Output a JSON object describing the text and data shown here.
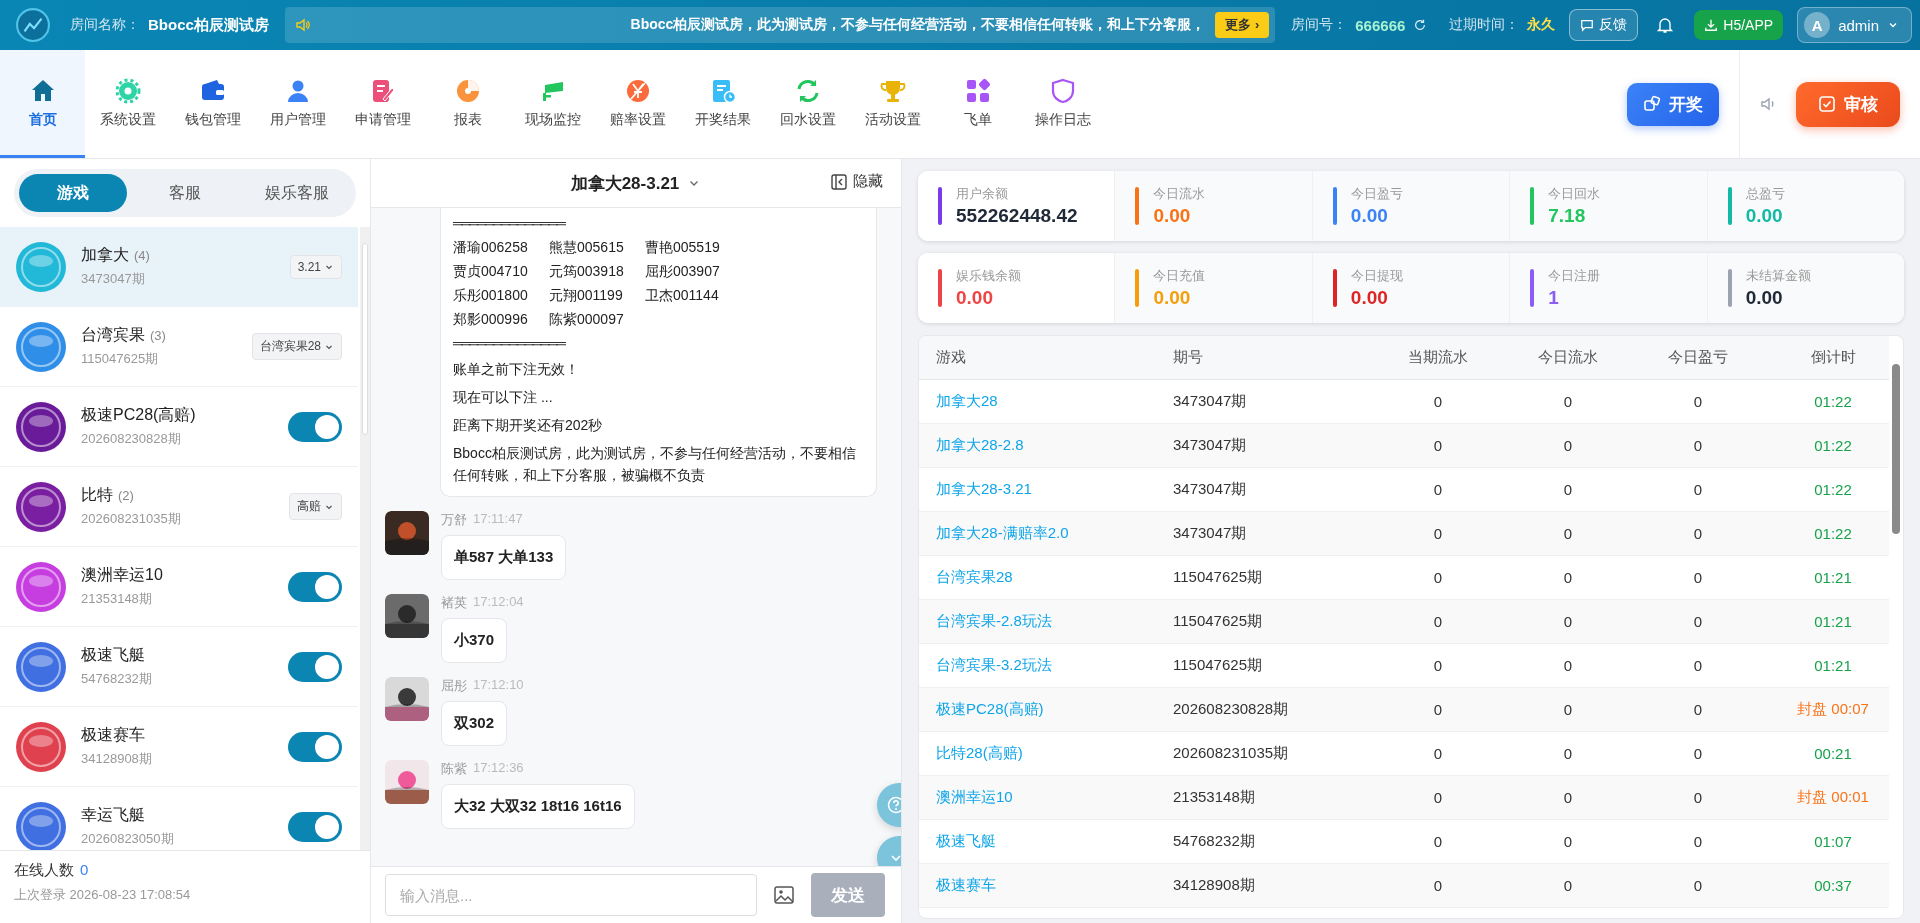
{
  "top_bar": {
    "room_label": "房间名称：",
    "room_name": "Bbocc柏辰测试房",
    "ticker": "Bbocc柏辰测试房，此为测试房，不参与任何经营活动，不要相信任何转账，和上下分客服，",
    "more_button": "更多 ›",
    "room_no_label": "房间号：",
    "room_no": "666666",
    "expire_label": "过期时间：",
    "expire": "永久",
    "feedback_button": "反馈",
    "app_button": "H5/APP",
    "user": {
      "avatar": "A",
      "name": "admin"
    }
  },
  "nav": [
    {
      "label": "首页",
      "selected": true
    },
    {
      "label": "系统设置",
      "selected": false
    },
    {
      "label": "钱包管理",
      "selected": false
    },
    {
      "label": "用户管理",
      "selected": false
    },
    {
      "label": "申请管理",
      "selected": false
    },
    {
      "label": "报表",
      "selected": false
    },
    {
      "label": "现场监控",
      "selected": false
    },
    {
      "label": "赔率设置",
      "selected": false
    },
    {
      "label": "开奖结果",
      "selected": false
    },
    {
      "label": "回水设置",
      "selected": false
    },
    {
      "label": "活动设置",
      "selected": false
    },
    {
      "label": "飞单",
      "selected": false
    },
    {
      "label": "操作日志",
      "selected": false
    }
  ],
  "draw_button": "开奖",
  "review_button": "审核",
  "left_tabs": [
    {
      "label": "游戏",
      "selected": true
    },
    {
      "label": "客服",
      "selected": false
    },
    {
      "label": "娱乐客服",
      "selected": false
    }
  ],
  "games": [
    {
      "name": "加拿大",
      "count": "(4)",
      "period": "3473047期",
      "kind": "select",
      "option": "3.21",
      "selected": true,
      "color": "#22b8d8"
    },
    {
      "name": "台湾宾果",
      "count": "(3)",
      "period": "115047625期",
      "kind": "select",
      "option": "台湾宾果28",
      "selected": false,
      "color": "#2f8fe8"
    },
    {
      "name": "极速PC28(高赔)",
      "period": "202608230828期",
      "kind": "toggle",
      "on": true,
      "selected": false,
      "color": "#6a1b9a"
    },
    {
      "name": "比特",
      "count": "(2)",
      "period": "202608231035期",
      "kind": "select",
      "option": "高赔",
      "selected": false,
      "color": "#7b1fa2"
    },
    {
      "name": "澳洲幸运10",
      "period": "21353148期",
      "kind": "toggle",
      "on": true,
      "selected": false,
      "color": "#c73ee0"
    },
    {
      "name": "极速飞艇",
      "period": "54768232期",
      "kind": "toggle",
      "on": true,
      "selected": false,
      "color": "#3f6fe0"
    },
    {
      "name": "极速赛车",
      "period": "34128908期",
      "kind": "toggle",
      "on": true,
      "selected": false,
      "color": "#e0414f"
    },
    {
      "name": "幸运飞艇",
      "period": "20260823050期",
      "kind": "toggle",
      "on": true,
      "selected": false,
      "color": "#3f6fe0"
    }
  ],
  "online": {
    "label": "在线人数",
    "count": "0",
    "last_login": "上次登录 2026-08-23 17:08:54"
  },
  "chat": {
    "title": "加拿大28-3.21",
    "hide_button": "隐藏",
    "notice": {
      "rule_top": "══════════════",
      "names": [
        [
          "潘瑜006258",
          "熊慧005615",
          "曹艳005519"
        ],
        [
          "贾贞004710",
          "元筠003918",
          "屈彤003907"
        ],
        [
          "乐彤001800",
          "元翔001199",
          "卫杰001144"
        ],
        [
          "郑影000996",
          "陈紫000097"
        ]
      ],
      "rule_bottom": "══════════════",
      "lines": [
        "账单之前下注无效！",
        "现在可以下注 ...",
        "距离下期开奖还有202秒",
        "Bbocc柏辰测试房，此为测试房，不参与任何经营活动，不要相信任何转账，和上下分客服，被骗概不负责"
      ]
    },
    "messages": [
      {
        "user": "万舒",
        "time": "17:11:47",
        "text": "单587 大单133"
      },
      {
        "user": "褚英",
        "time": "17:12:04",
        "text": "小370"
      },
      {
        "user": "屈彤",
        "time": "17:12:10",
        "text": "双302"
      },
      {
        "user": "陈紫",
        "time": "17:12:36",
        "text": "大32 大双32 18t16 16t16"
      }
    ],
    "input": {
      "placeholder": "输入消息..."
    },
    "send_button": "发送"
  },
  "stats": [
    [
      {
        "label": "用户余额",
        "value": "552262448.42",
        "color": "#7c3aed",
        "kind": "dark"
      },
      {
        "label": "今日流水",
        "value": "0.00",
        "color": "#f97316",
        "kind": "accent"
      },
      {
        "label": "今日盈亏",
        "value": "0.00",
        "color": "#3b82f6",
        "kind": "accent"
      },
      {
        "label": "今日回水",
        "value": "7.18",
        "color": "#22c55e",
        "kind": "accent"
      },
      {
        "label": "总盈亏",
        "value": "0.00",
        "color": "#14b8a6",
        "kind": "accent"
      }
    ],
    [
      {
        "label": "娱乐钱余额",
        "value": "0.00",
        "color": "#ef4444",
        "kind": "accent"
      },
      {
        "label": "今日充值",
        "value": "0.00",
        "color": "#f59e0b",
        "kind": "accent"
      },
      {
        "label": "今日提现",
        "value": "0.00",
        "color": "#dc2626",
        "kind": "accent"
      },
      {
        "label": "今日注册",
        "value": "1",
        "color": "#8b5cf6",
        "kind": "accent"
      },
      {
        "label": "未结算金额",
        "value": "0.00",
        "color": "#9ca3af",
        "kind": "dark"
      }
    ]
  ],
  "table": {
    "columns": [
      "游戏",
      "期号",
      "当期流水",
      "今日流水",
      "今日盈亏",
      "倒计时"
    ],
    "rows": [
      {
        "game": "加拿大28",
        "period": "3473047期",
        "current": "0",
        "today_flow": "0",
        "today_pl": "0",
        "countdown": "01:22",
        "kind": "open"
      },
      {
        "game": "加拿大28-2.8",
        "period": "3473047期",
        "current": "0",
        "today_flow": "0",
        "today_pl": "0",
        "countdown": "01:22",
        "kind": "open"
      },
      {
        "game": "加拿大28-3.21",
        "period": "3473047期",
        "current": "0",
        "today_flow": "0",
        "today_pl": "0",
        "countdown": "01:22",
        "kind": "open"
      },
      {
        "game": "加拿大28-满赔率2.0",
        "period": "3473047期",
        "current": "0",
        "today_flow": "0",
        "today_pl": "0",
        "countdown": "01:22",
        "kind": "open"
      },
      {
        "game": "台湾宾果28",
        "period": "115047625期",
        "current": "0",
        "today_flow": "0",
        "today_pl": "0",
        "countdown": "01:21",
        "kind": "open"
      },
      {
        "game": "台湾宾果-2.8玩法",
        "period": "115047625期",
        "current": "0",
        "today_flow": "0",
        "today_pl": "0",
        "countdown": "01:21",
        "kind": "open"
      },
      {
        "game": "台湾宾果-3.2玩法",
        "period": "115047625期",
        "current": "0",
        "today_flow": "0",
        "today_pl": "0",
        "countdown": "01:21",
        "kind": "open"
      },
      {
        "game": "极速PC28(高赔)",
        "period": "202608230828期",
        "current": "0",
        "today_flow": "0",
        "today_pl": "0",
        "countdown": "封盘 00:07",
        "kind": "sealed"
      },
      {
        "game": "比特28(高赔)",
        "period": "202608231035期",
        "current": "0",
        "today_flow": "0",
        "today_pl": "0",
        "countdown": "00:21",
        "kind": "open"
      },
      {
        "game": "澳洲幸运10",
        "period": "21353148期",
        "current": "0",
        "today_flow": "0",
        "today_pl": "0",
        "countdown": "封盘 00:01",
        "kind": "sealed"
      },
      {
        "game": "极速飞艇",
        "period": "54768232期",
        "current": "0",
        "today_flow": "0",
        "today_pl": "0",
        "countdown": "01:07",
        "kind": "open"
      },
      {
        "game": "极速赛车",
        "period": "34128908期",
        "current": "0",
        "today_flow": "0",
        "today_pl": "0",
        "countdown": "00:37",
        "kind": "open"
      }
    ]
  }
}
